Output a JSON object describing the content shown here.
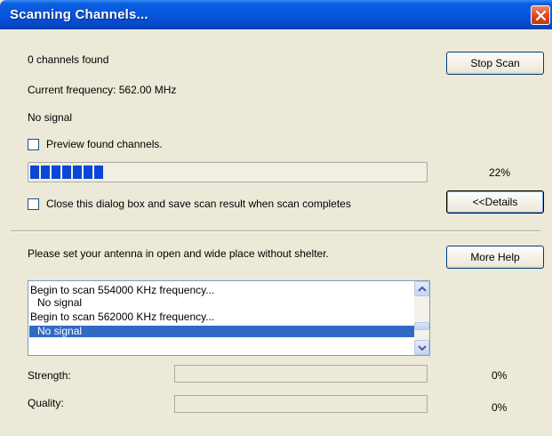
{
  "window": {
    "title": "Scanning Channels..."
  },
  "status": {
    "channels_found": "0 channels found",
    "current_frequency": "Current frequency: 562.00 MHz",
    "signal_state": "No signal"
  },
  "preview_checkbox": {
    "label": "Preview found channels.",
    "checked": false
  },
  "scan_progress": {
    "percent_label": "22%",
    "fraction": 0.22
  },
  "close_checkbox": {
    "label": "Close this dialog box and save scan result when scan completes",
    "checked": false
  },
  "buttons": {
    "stop_scan": "Stop Scan",
    "details": "<<Details",
    "more_help": "More Help"
  },
  "hint": "Please set your antenna in open and wide place without shelter.",
  "log": [
    {
      "text": "Begin to scan 554000 KHz frequency...",
      "selected": false,
      "indent": false
    },
    {
      "text": "No signal",
      "selected": false,
      "indent": true
    },
    {
      "text": "Begin to scan 562000 KHz frequency...",
      "selected": false,
      "indent": false
    },
    {
      "text": "No signal",
      "selected": true,
      "indent": true
    }
  ],
  "strength": {
    "label": "Strength:",
    "value": "0%"
  },
  "quality": {
    "label": "Quality:",
    "value": "0%"
  }
}
